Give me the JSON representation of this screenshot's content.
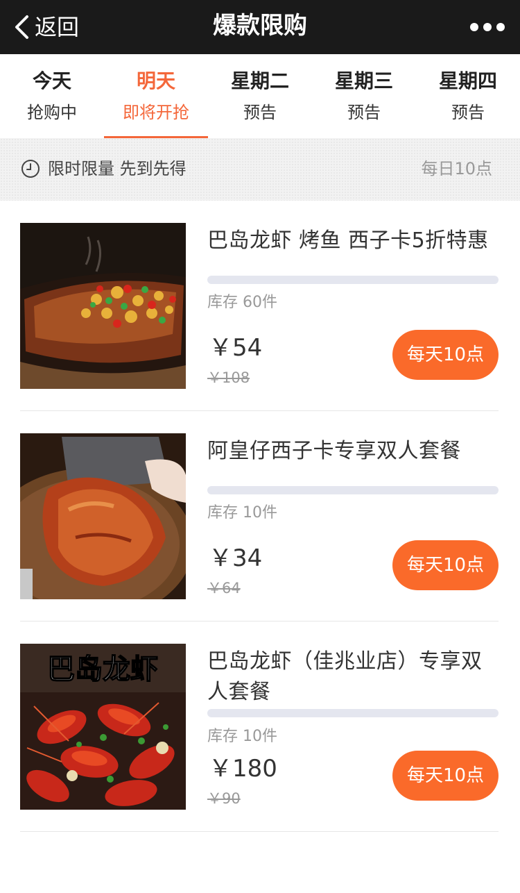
{
  "header": {
    "back_label": "返回",
    "title": "爆款限购",
    "more_icon": "more-dots-icon"
  },
  "tabs": [
    {
      "day": "今天",
      "status": "抢购中",
      "active": false
    },
    {
      "day": "明天",
      "status": "即将开抢",
      "active": true
    },
    {
      "day": "星期二",
      "status": "预告",
      "active": false
    },
    {
      "day": "星期三",
      "status": "预告",
      "active": false
    },
    {
      "day": "星期四",
      "status": "预告",
      "active": false
    }
  ],
  "notice": {
    "icon": "clock-icon",
    "text": "限时限量 先到先得",
    "time": "每日10点"
  },
  "items": [
    {
      "name": "巴岛龙虾 烤鱼 西子卡5折特惠",
      "stock": "库存 60件",
      "price": "￥54",
      "original_price": "￥108",
      "button_label": "每天10点",
      "sold_fraction": 0,
      "image": "grilled-fish-photo"
    },
    {
      "name": "阿皇仔西子卡专享双人套餐",
      "stock": "库存 10件",
      "price": "￥34",
      "original_price": "￥64",
      "button_label": "每天10点",
      "sold_fraction": 0,
      "image": "roast-goose-photo"
    },
    {
      "name": "巴岛龙虾（佳兆业店）专享双人套餐",
      "stock": "库存 10件",
      "price": "￥180",
      "original_price": "￥90",
      "button_label": "每天10点",
      "sold_fraction": 0,
      "image": "crayfish-photo",
      "image_caption": "巴岛龙虾"
    }
  ],
  "colors": {
    "accent": "#f4673a",
    "button": "#fa6a2a",
    "navbar": "#1a1a1a",
    "progress_track": "#e4e6ef"
  }
}
